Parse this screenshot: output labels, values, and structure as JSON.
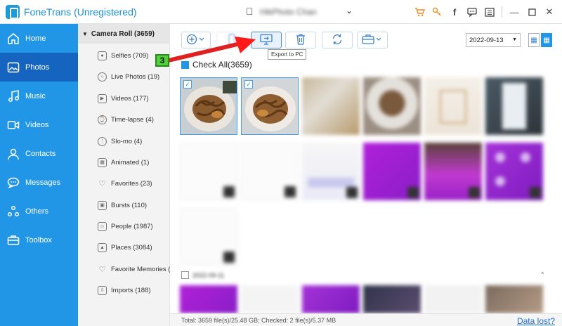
{
  "app": {
    "title": "FoneTrans (Unregistered)",
    "device_name": "HikPhoto Chan",
    "titlebar_icons": [
      "cart-icon",
      "key-icon",
      "facebook-icon",
      "chat-icon",
      "menu-icon",
      "minimize-icon",
      "maximize-icon",
      "close-icon"
    ]
  },
  "nav": {
    "items": [
      {
        "label": "Home",
        "icon": "home-icon"
      },
      {
        "label": "Photos",
        "icon": "photos-icon",
        "active": true
      },
      {
        "label": "Music",
        "icon": "music-icon"
      },
      {
        "label": "Videos",
        "icon": "videos-icon"
      },
      {
        "label": "Contacts",
        "icon": "contacts-icon"
      },
      {
        "label": "Messages",
        "icon": "messages-icon"
      },
      {
        "label": "Others",
        "icon": "others-icon"
      },
      {
        "label": "Toolbox",
        "icon": "toolbox-icon"
      }
    ]
  },
  "categories": {
    "header": "Camera Roll (3659)",
    "items": [
      {
        "label": "Selfies (709)"
      },
      {
        "label": "Live Photos (19)"
      },
      {
        "label": "Videos (177)"
      },
      {
        "label": "Time-lapse (4)"
      },
      {
        "label": "Slo-mo (4)"
      },
      {
        "label": "Animated (1)"
      },
      {
        "label": "Favorites (23)"
      },
      {
        "label": "Bursts (110)"
      },
      {
        "label": "People (1987)"
      },
      {
        "label": "Places (3084)"
      },
      {
        "label": "Favorite Memories (..."
      },
      {
        "label": "Imports (188)"
      }
    ]
  },
  "toolbar": {
    "tooltip": "Export to PC",
    "date_value": "2022-09-13"
  },
  "content": {
    "check_all_label": "Check All(3659)",
    "date_group": "2022-09-11"
  },
  "footer": {
    "status": "Total: 3659 file(s)/25.48 GB; Checked: 2 file(s)/5.37 MB",
    "data_lost": "Data lost?"
  },
  "annotation": {
    "step": "3"
  },
  "colors": {
    "accent": "#2196e6",
    "nav_active": "#1565c0",
    "brand_text": "#1c8fd0",
    "step_badge": "#4fd13b",
    "arrow": "#ff1a1a"
  }
}
